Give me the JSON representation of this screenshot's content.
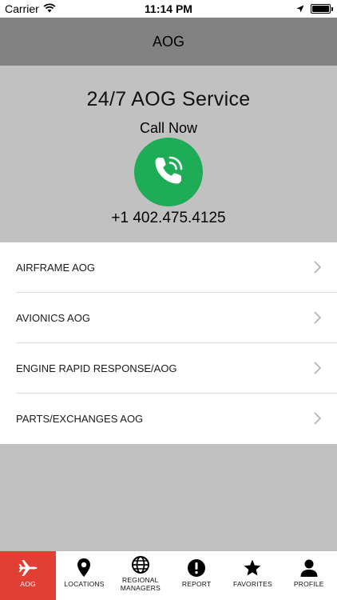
{
  "status_bar": {
    "carrier": "Carrier",
    "time": "11:14 PM"
  },
  "nav": {
    "title": "AOG"
  },
  "hero": {
    "title": "24/7 AOG Service",
    "subtitle": "Call Now",
    "phone": "+1 402.475.4125",
    "call_button_color": "#1fac57"
  },
  "menu": {
    "items": [
      {
        "label": "AIRFRAME AOG"
      },
      {
        "label": "AVIONICS AOG"
      },
      {
        "label": "ENGINE RAPID RESPONSE/AOG"
      },
      {
        "label": "PARTS/EXCHANGES AOG"
      }
    ]
  },
  "tabbar": {
    "active_color": "#e23f34",
    "tabs": [
      {
        "label": "AOG",
        "icon": "airplane-icon",
        "active": true
      },
      {
        "label": "LOCATIONS",
        "icon": "location-pin-icon",
        "active": false
      },
      {
        "label": "REGIONAL MANAGERS",
        "icon": "globe-icon",
        "active": false
      },
      {
        "label": "REPORT",
        "icon": "alert-icon",
        "active": false
      },
      {
        "label": "FAVORITES",
        "icon": "star-icon",
        "active": false
      },
      {
        "label": "PROFILE",
        "icon": "person-icon",
        "active": false
      }
    ]
  }
}
